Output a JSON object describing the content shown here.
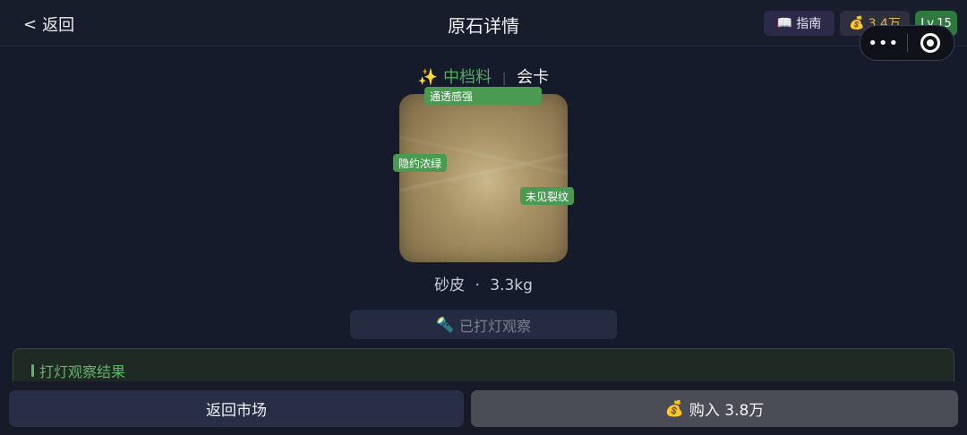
{
  "header": {
    "back_chevron": "<",
    "back_label": "返回",
    "title": "原石详情",
    "guide_icon": "📖",
    "guide_label": "指南",
    "coin_icon": "💰",
    "coin_value": "3.4万",
    "level": "Lv.15"
  },
  "capsule": {
    "more_glyph": "•••"
  },
  "stone": {
    "grade_icon": "✨",
    "grade": "中档料",
    "type": "会卡",
    "tags": [
      "通透感强",
      "隐约浓绿",
      "未见裂纹"
    ],
    "skin": "砂皮",
    "separator": "·",
    "weight": "3.3kg"
  },
  "inspect": {
    "icon": "🔦",
    "label": "已打灯观察"
  },
  "result": {
    "title": "打灯观察结果"
  },
  "actions": {
    "market_label": "返回市场",
    "buy_icon": "💰",
    "buy_label": "购入 3.8万"
  }
}
